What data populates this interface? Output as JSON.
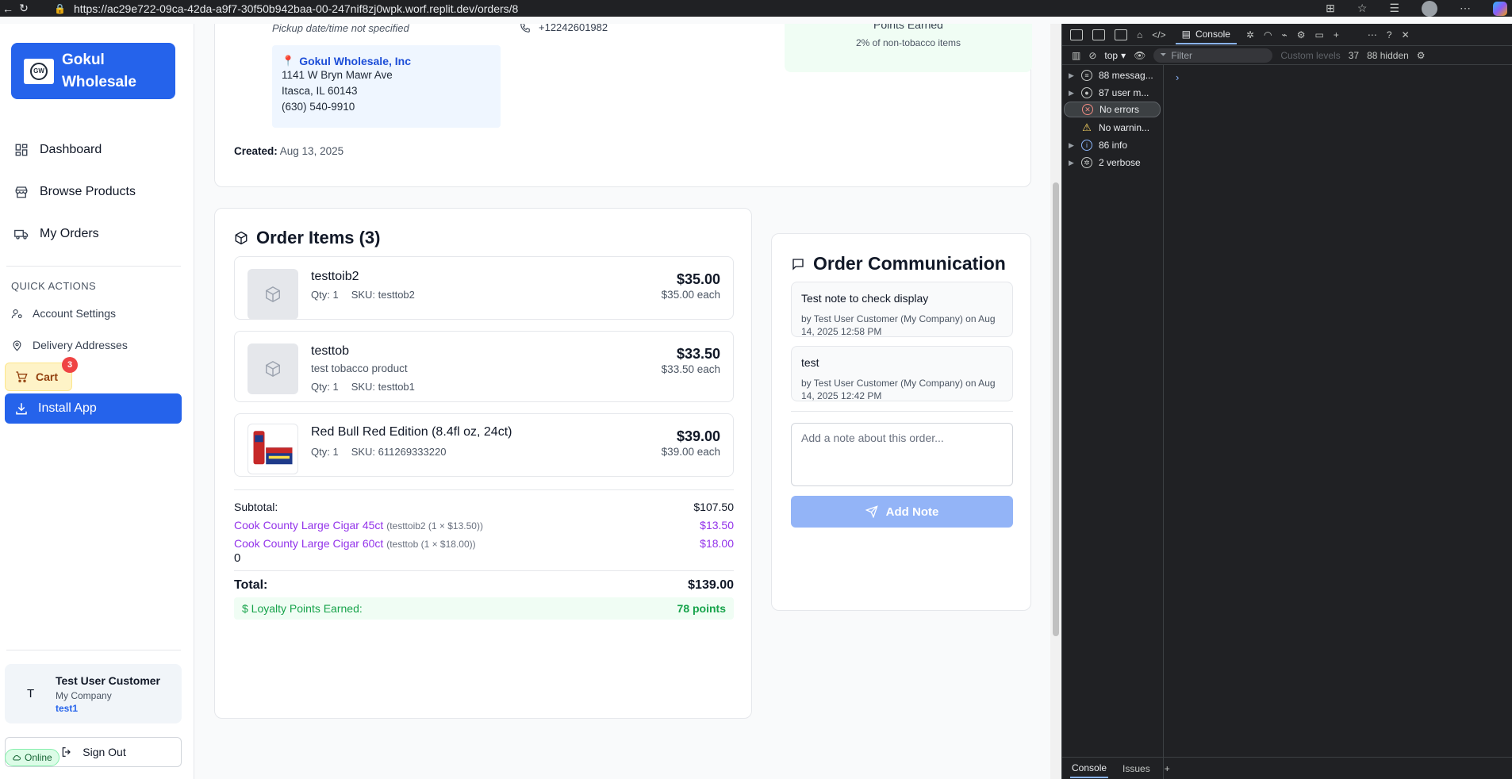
{
  "browser": {
    "url": "https://ac29e722-09ca-42da-a9f7-30f50b942baa-00-247nif8zj0wpk.worf.replit.dev/orders/8"
  },
  "sidebar": {
    "logo_mark": "GW",
    "brand": "Gokul Wholesale",
    "nav": [
      {
        "label": "Dashboard",
        "icon": "dashboard-icon"
      },
      {
        "label": "Browse Products",
        "icon": "store-icon"
      },
      {
        "label": "My Orders",
        "icon": "truck-icon"
      }
    ],
    "quick_actions_title": "QUICK ACTIONS",
    "quick_actions": [
      {
        "label": "Account Settings",
        "icon": "user-settings-icon"
      },
      {
        "label": "Delivery Addresses",
        "icon": "map-pin-icon"
      }
    ],
    "cart_label": "Cart",
    "cart_count": "3",
    "install_label": "Install App",
    "user": {
      "initial": "T",
      "name": "Test User Customer",
      "company": "My Company",
      "handle": "test1"
    },
    "signout_label": "Sign Out",
    "online_label": "Online"
  },
  "order": {
    "pickup_note": "Pickup date/time not specified",
    "phone": "+12242601982",
    "store": {
      "name": "Gokul Wholesale, Inc",
      "address1": "1141 W Bryn Mawr Ave",
      "address2": "Itasca, IL 60143",
      "phone": "(630) 540-9910"
    },
    "created_label": "Created:",
    "created_date": "Aug 13, 2025",
    "points_title": "Points Earned",
    "points_sub": "2% of non-tobacco items"
  },
  "items": {
    "title": "Order Items (3)",
    "list": [
      {
        "name": "testtoib2",
        "desc": "",
        "qty": "Qty: 1",
        "sku": "SKU: testtob2",
        "price": "$35.00",
        "each": "$35.00 each"
      },
      {
        "name": "testtob",
        "desc": "test tobacco product",
        "qty": "Qty: 1",
        "sku": "SKU: testtob1",
        "price": "$33.50",
        "each": "$33.50 each"
      },
      {
        "name": "Red Bull Red Edition (8.4fl oz, 24ct)",
        "desc": "",
        "qty": "Qty: 1",
        "sku": "SKU: 611269333220",
        "price": "$39.00",
        "each": "$39.00 each"
      }
    ],
    "subtotal_label": "Subtotal:",
    "subtotal": "$107.50",
    "taxes": [
      {
        "label": "Cook County Large Cigar 45ct",
        "detail": "(testtoib2 (1 × $13.50))",
        "value": "$13.50"
      },
      {
        "label": "Cook County Large Cigar 60ct",
        "detail": "(testtob (1 × $18.00))",
        "value": "$18.00"
      }
    ],
    "zero_line": "0",
    "total_label": "Total:",
    "total": "$139.00",
    "loyalty_label": "$  Loyalty Points Earned:",
    "loyalty_value": "78 points"
  },
  "communication": {
    "title": "Order Communication",
    "notes": [
      {
        "text": "Test note to check display",
        "by": "by Test User Customer (My Company) on Aug 14, 2025 12:58 PM"
      },
      {
        "text": "test",
        "by": "by Test User Customer (My Company) on Aug 14, 2025 12:42 PM"
      }
    ],
    "input_placeholder": "Add a note about this order...",
    "add_note_label": "Add Note"
  },
  "devtools": {
    "console_tab": "Console",
    "context": "top",
    "filter_placeholder": "Filter",
    "levels": "Custom levels",
    "count": "37",
    "hidden": "88 hidden",
    "sidebar": [
      {
        "label": "88 messag...",
        "type": "messages"
      },
      {
        "label": "87 user m...",
        "type": "user"
      },
      {
        "label": "No errors",
        "type": "err"
      },
      {
        "label": "No warnin...",
        "type": "warn"
      },
      {
        "label": "86 info",
        "type": "info"
      },
      {
        "label": "2 verbose",
        "type": "verbose"
      }
    ],
    "prompt": "›",
    "bottom_tabs": [
      "Console",
      "Issues"
    ]
  }
}
